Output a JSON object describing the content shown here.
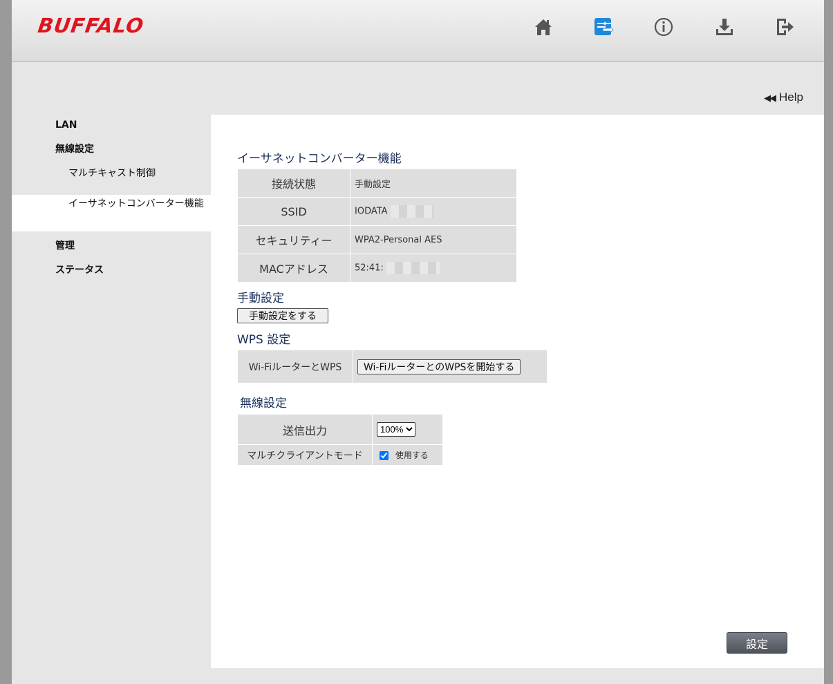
{
  "header": {
    "logo": "BUFFALO",
    "icons": [
      "home-icon",
      "wireless-settings-icon",
      "info-icon",
      "download-icon",
      "logout-icon"
    ],
    "accent_color": "#1e88d8"
  },
  "help": {
    "label": "Help"
  },
  "sidebar": {
    "items": [
      {
        "label": "LAN"
      },
      {
        "label": "無線設定"
      },
      {
        "label": "マルチキャスト制御"
      },
      {
        "label": "イーサネットコンバーター機能"
      },
      {
        "label": "管理"
      },
      {
        "label": "ステータス"
      }
    ]
  },
  "main": {
    "title": "イーサネットコンバーター機能",
    "status_table": [
      {
        "label": "接続状態",
        "value": "手動設定"
      },
      {
        "label": "SSID",
        "value": "IODATA"
      },
      {
        "label": "セキュリティー",
        "value": "WPA2-Personal AES"
      },
      {
        "label": "MACアドレス",
        "value": "52:41:"
      }
    ],
    "manual": {
      "title": "手動設定",
      "button": "手動設定をする"
    },
    "wps": {
      "title": "WPS 設定",
      "label": "Wi-FiルーターとWPS",
      "button": "Wi-FiルーターとのWPSを開始する"
    },
    "wireless": {
      "title": "無線設定",
      "power_label": "送信出力",
      "power_value": "100%",
      "multi_label": "マルチクライアントモード",
      "multi_checked": true,
      "multi_option": "使用する"
    },
    "apply_button": "設定"
  }
}
